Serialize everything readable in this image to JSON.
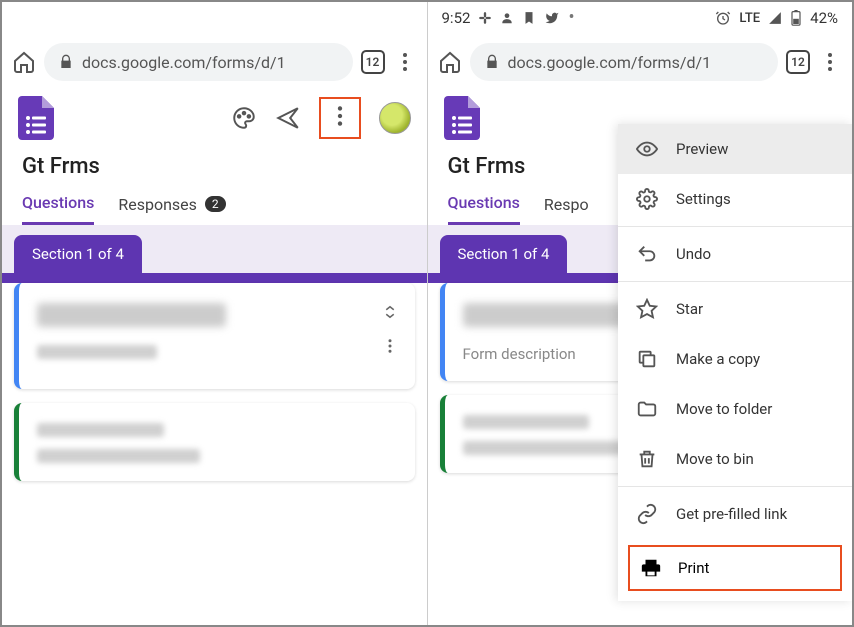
{
  "status": {
    "time": "9:52",
    "network": "LTE",
    "battery": "42%"
  },
  "addr": {
    "url": "docs.google.com/forms/d/1",
    "tabs": "12"
  },
  "forms": {
    "title": "Gt Frms",
    "tabs": {
      "questions": "Questions",
      "responses": "Responses",
      "responses_short": "Respo",
      "count": "2"
    },
    "section": "Section 1 of 4",
    "desc_placeholder": "Form description"
  },
  "menu": {
    "preview": "Preview",
    "settings": "Settings",
    "undo": "Undo",
    "star": "Star",
    "copy": "Make a copy",
    "move": "Move to folder",
    "bin": "Move to bin",
    "prefilled": "Get pre-filled link",
    "print": "Print"
  }
}
